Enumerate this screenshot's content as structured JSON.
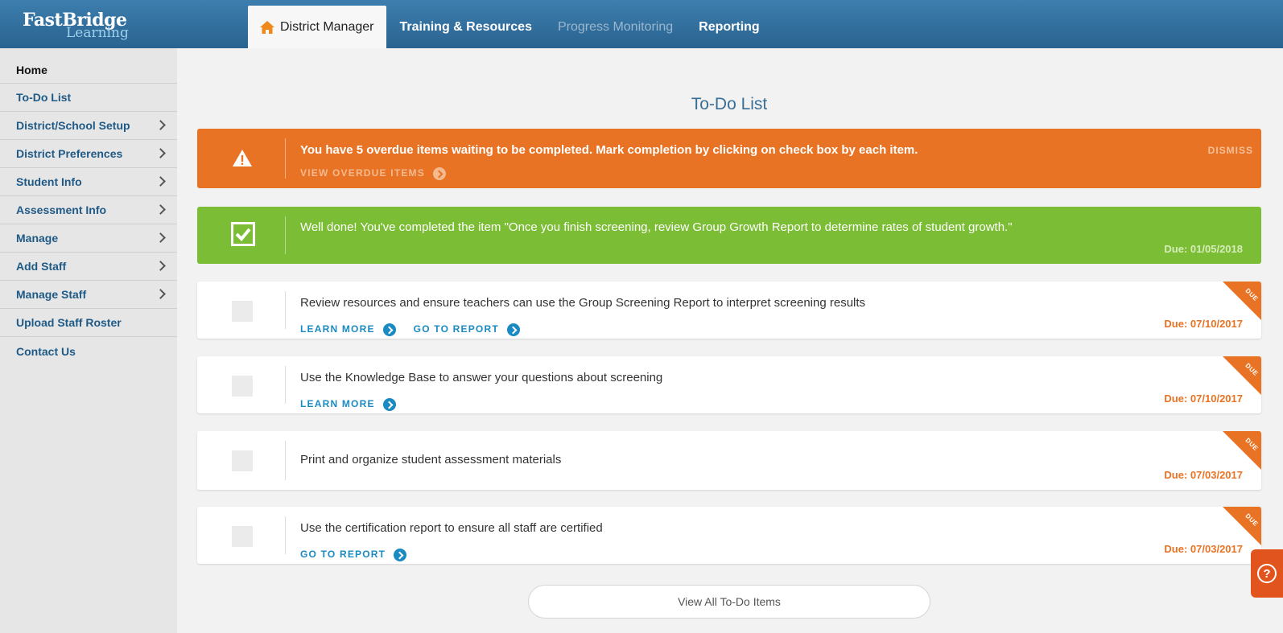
{
  "logo": {
    "line1": "FastBridge",
    "line2": "Learning"
  },
  "nav": {
    "tabs": [
      {
        "label": "District Manager"
      },
      {
        "label": "Training & Resources"
      },
      {
        "label": "Progress Monitoring"
      },
      {
        "label": "Reporting"
      }
    ]
  },
  "sidebar": {
    "items": [
      {
        "label": "Home"
      },
      {
        "label": "To-Do List"
      },
      {
        "label": "District/School Setup"
      },
      {
        "label": "District Preferences"
      },
      {
        "label": "Student Info"
      },
      {
        "label": "Assessment Info"
      },
      {
        "label": "Manage"
      },
      {
        "label": "Add Staff"
      },
      {
        "label": "Manage Staff"
      },
      {
        "label": "Upload Staff Roster"
      },
      {
        "label": "Contact Us"
      }
    ]
  },
  "main": {
    "title": "To-Do List",
    "overdue": {
      "text": "You have 5 overdue items waiting to be completed. Mark completion by clicking on check box by each item.",
      "link": "VIEW OVERDUE ITEMS",
      "dismiss": "DISMISS"
    },
    "completed": {
      "text": "Well done! You've completed the item \"Once you finish screening, review Group Growth Report to determine rates of student growth.\"",
      "due": "Due: 01/05/2018"
    },
    "items": [
      {
        "text": "Review resources and ensure teachers can use the Group Screening Report to interpret screening results",
        "links": [
          "LEARN MORE",
          "GO TO REPORT"
        ],
        "due": "Due: 07/10/2017",
        "badge": "DUE"
      },
      {
        "text": "Use the Knowledge Base to answer your questions about screening",
        "links": [
          "LEARN MORE"
        ],
        "due": "Due: 07/10/2017",
        "badge": "DUE"
      },
      {
        "text": "Print and organize student assessment materials",
        "links": [],
        "due": "Due: 07/03/2017",
        "badge": "DUE"
      },
      {
        "text": "Use the certification report to ensure all staff are certified",
        "links": [
          "GO TO REPORT"
        ],
        "due": "Due: 07/03/2017",
        "badge": "DUE"
      }
    ],
    "view_all": "View All To-Do Items"
  },
  "help": {
    "label": "?"
  },
  "colors": {
    "header": "#2f6c99",
    "orange": "#e87324",
    "green": "#7bbd34",
    "link": "#1a8ac2"
  }
}
